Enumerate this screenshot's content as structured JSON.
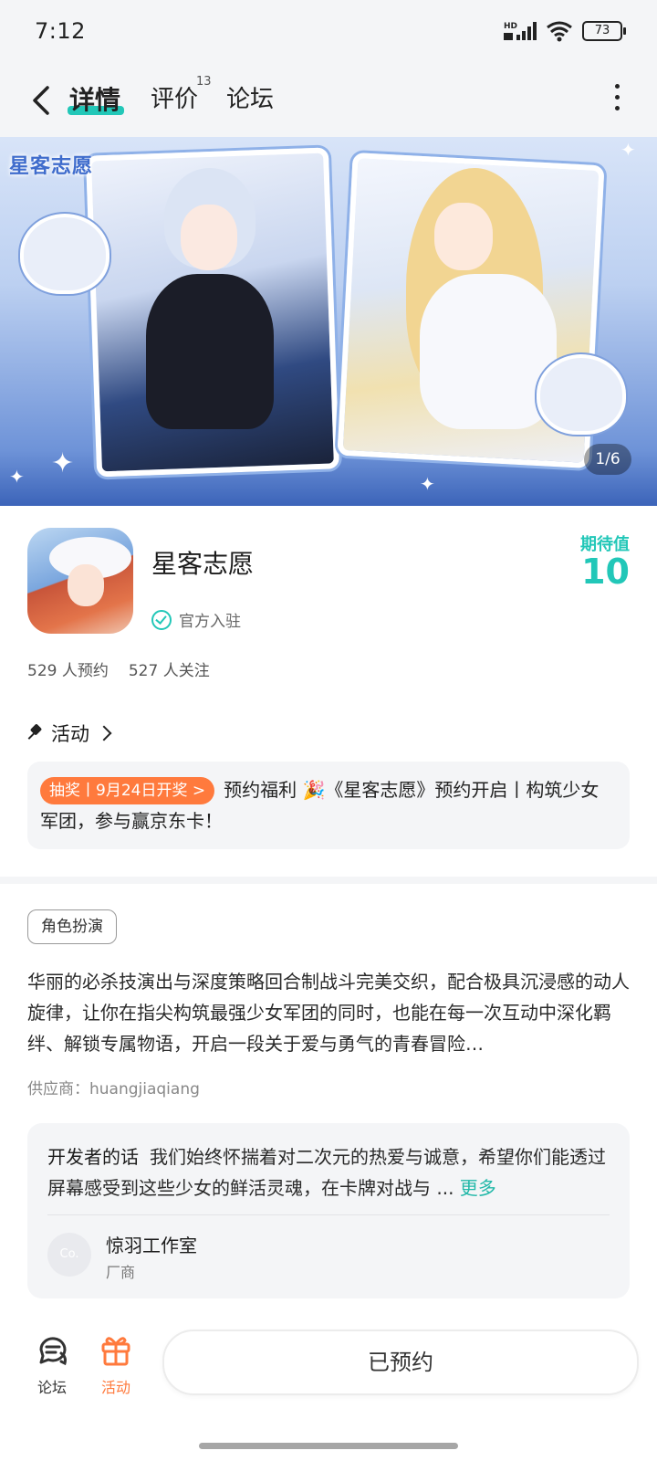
{
  "status_bar": {
    "time": "7:12",
    "network": "HD",
    "battery": "73"
  },
  "nav": {
    "tabs": [
      {
        "label": "详情",
        "active": true
      },
      {
        "label": "评价",
        "badge": "13"
      },
      {
        "label": "论坛"
      }
    ]
  },
  "hero": {
    "logo_text": "星客志愿",
    "counter": "1/6"
  },
  "game": {
    "title": "星客志愿",
    "verified_label": "官方入驻",
    "expect_label": "期待值",
    "expect_value": "10",
    "reservations": "529 人预约",
    "followers": "527 人关注"
  },
  "activity": {
    "heading": "活动",
    "tag": "抽奖丨9月24日开奖 >",
    "text": "预约福利 🎉《星客志愿》预约开启丨构筑少女军团，参与赢京东卡！"
  },
  "description": {
    "genre": "角色扮演",
    "text": "华丽的必杀技演出与深度策略回合制战斗完美交织，配合极具沉浸感的动人旋律，让你在指尖构筑最强少女军团的同时，也能在每一次互动中深化羁绊、解锁专属物语，开启一段关于爱与勇气的青春冒险…",
    "supplier": "供应商：huangjiaqiang"
  },
  "developer": {
    "label": "开发者的话",
    "text": "我们始终怀揣着对二次元的热爱与诚意，希望你们能透过屏幕感受到这些少女的鲜活灵魂，在卡牌对战与 ...",
    "more": "更多",
    "avatar_text": "Co.",
    "name": "惊羽工作室",
    "role": "厂商"
  },
  "bottom_bar": {
    "forum_label": "论坛",
    "activity_label": "活动",
    "reserve_label": "已预约"
  },
  "colors": {
    "accent": "#22c7b8",
    "orange": "#ff7a3d",
    "banner_blue": "#3c64b9"
  }
}
